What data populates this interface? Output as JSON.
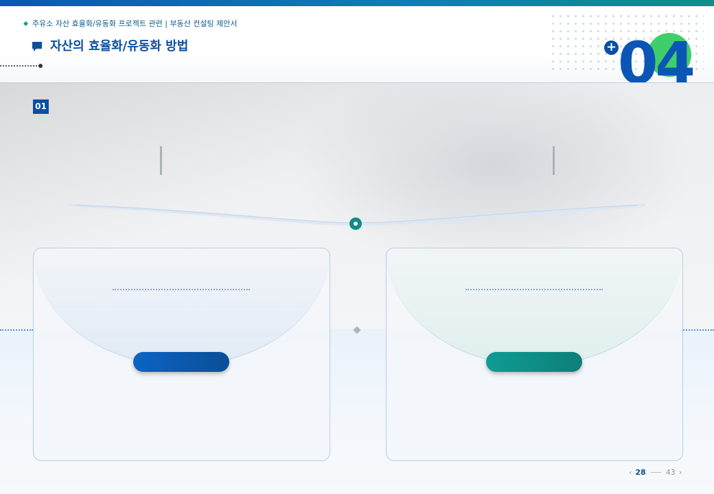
{
  "header": {
    "breadcrumb": "주유소 자산 효율화/유동화 프로젝트 관련 | 부동산 컨설팅 제안서",
    "section_title": "자산의 효율화/유동화 방법",
    "subtitle": "",
    "section_number": "04"
  },
  "content": {
    "item_number": "01",
    "item_title": "",
    "intro": {
      "line1": "",
      "line2_prefix": "",
      "highlight1": "",
      "highlight2": "",
      "line2_suffix": ""
    }
  },
  "cards": [
    {
      "title": "",
      "desc_line1": "",
      "desc_line2": "",
      "button": "",
      "body_line1": "",
      "body_line2": "",
      "body_line3": "",
      "accent": "#0b5bbd"
    },
    {
      "title": "",
      "desc_line1": "",
      "desc_line2": "",
      "button": "",
      "body_line1": "",
      "body_line2": "",
      "body_line3": "",
      "accent": "#0f8f88"
    }
  ],
  "pager": {
    "prev_icon": "chevron-left-icon",
    "current": "28",
    "total": "43",
    "next_icon": "chevron-right-icon"
  },
  "colors": {
    "primary": "#0b4fa3",
    "teal": "#0f8f88",
    "green": "#3fcf6a"
  }
}
